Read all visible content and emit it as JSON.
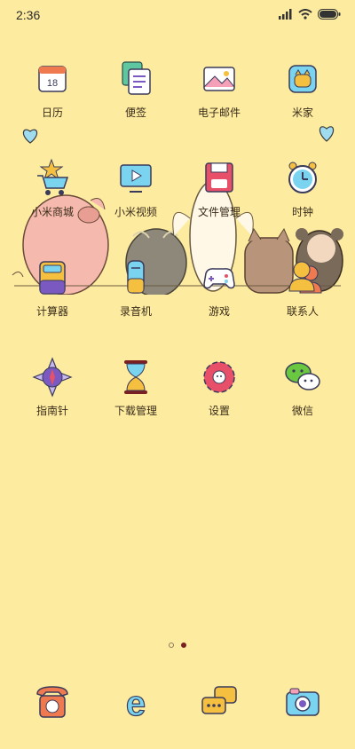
{
  "status_bar": {
    "time": "2:36"
  },
  "apps": [
    {
      "label": "日历",
      "icon": "calendar-icon",
      "date": "18"
    },
    {
      "label": "便签",
      "icon": "notes-icon"
    },
    {
      "label": "电子邮件",
      "icon": "email-icon"
    },
    {
      "label": "米家",
      "icon": "mijia-icon"
    },
    {
      "label": "小米商城",
      "icon": "shopping-cart-icon"
    },
    {
      "label": "小米视频",
      "icon": "video-icon"
    },
    {
      "label": "文件管理",
      "icon": "file-manager-icon"
    },
    {
      "label": "时钟",
      "icon": "clock-icon"
    },
    {
      "label": "计算器",
      "icon": "calculator-icon"
    },
    {
      "label": "录音机",
      "icon": "recorder-icon"
    },
    {
      "label": "游戏",
      "icon": "gamepad-icon"
    },
    {
      "label": "联系人",
      "icon": "contacts-icon"
    },
    {
      "label": "指南针",
      "icon": "compass-icon"
    },
    {
      "label": "下载管理",
      "icon": "hourglass-icon"
    },
    {
      "label": "设置",
      "icon": "settings-gear-icon"
    },
    {
      "label": "微信",
      "icon": "wechat-icon"
    }
  ],
  "dock": [
    {
      "icon": "phone-icon"
    },
    {
      "icon": "browser-icon",
      "glyph": "e"
    },
    {
      "icon": "messages-icon"
    },
    {
      "icon": "camera-icon"
    }
  ],
  "page_indicator": {
    "total": 2,
    "current": 2
  },
  "colors": {
    "background": "#fdeca0",
    "active_dot": "#7a1f22"
  }
}
